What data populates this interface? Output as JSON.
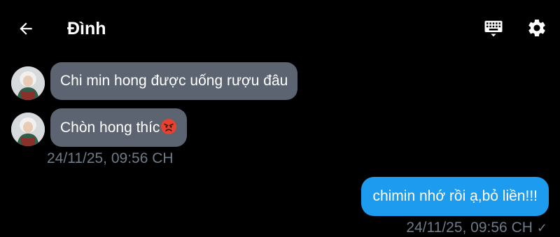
{
  "header": {
    "title": "Đình"
  },
  "messages": {
    "incoming": [
      {
        "text": "Chi min hong được uống rượu đâu"
      },
      {
        "text": "Chòn hong thíc"
      }
    ],
    "incoming_time": "24/11/25, 09:56 CH",
    "outgoing": [
      {
        "text": "chimin nhớ rồi ạ,bỏ liền!!!"
      }
    ],
    "outgoing_time": "24/11/25, 09:56 CH",
    "outgoing_status": "✓"
  },
  "colors": {
    "background": "#000000",
    "incoming_bubble": "#5b6470",
    "outgoing_bubble": "#1c9bef",
    "timestamp": "#6e7b87"
  },
  "icons": {
    "back": "arrow-left-icon",
    "keyboard": "keyboard-icon",
    "settings": "gear-icon",
    "emoji": "angry-face-emoji"
  }
}
